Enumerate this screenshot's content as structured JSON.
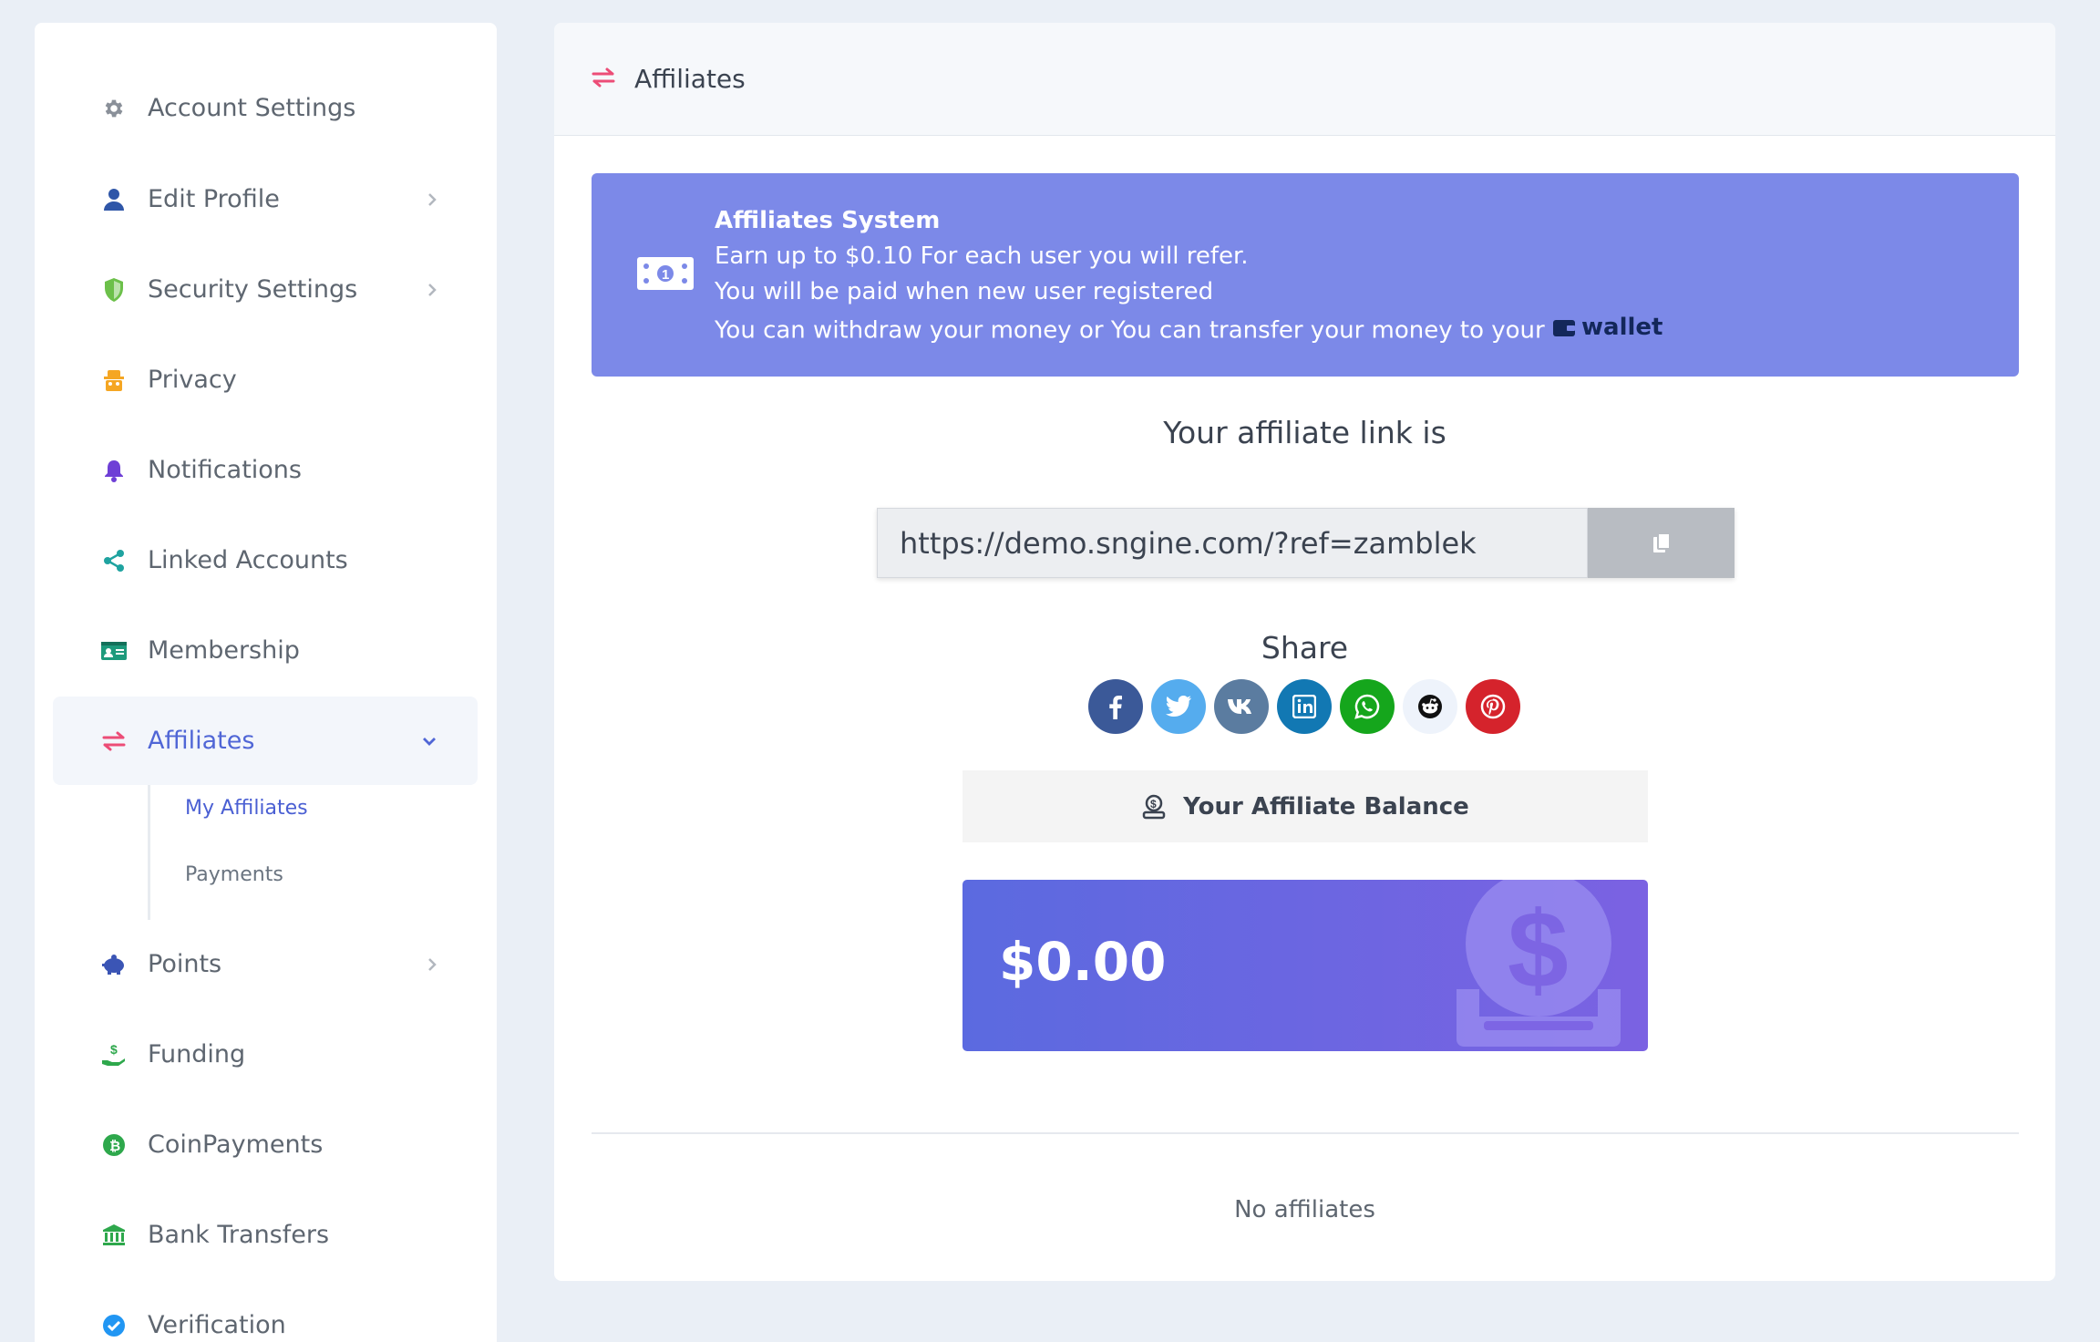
{
  "sidebar": {
    "items": [
      {
        "label": "Account Settings",
        "icon": "gear-icon",
        "color": "#8a9099"
      },
      {
        "label": "Edit Profile",
        "icon": "user-icon",
        "color": "#2f56a8"
      },
      {
        "label": "Security Settings",
        "icon": "shield-icon",
        "color": "#6cc04a"
      },
      {
        "label": "Privacy",
        "icon": "privacy-icon",
        "color": "#f5a623"
      },
      {
        "label": "Notifications",
        "icon": "bell-icon",
        "color": "#6e3fd6"
      },
      {
        "label": "Linked Accounts",
        "icon": "share-nodes-icon",
        "color": "#1fa3a0"
      },
      {
        "label": "Membership",
        "icon": "id-card-icon",
        "color": "#1d9a7c"
      },
      {
        "label": "Affiliates",
        "icon": "exchange-icon",
        "color": "#ec4d77"
      },
      {
        "label": "Points",
        "icon": "piggy-bank-icon",
        "color": "#3b55b5"
      },
      {
        "label": "Funding",
        "icon": "hand-money-icon",
        "color": "#2ea84c"
      },
      {
        "label": "CoinPayments",
        "icon": "bitcoin-icon",
        "color": "#2ea84c"
      },
      {
        "label": "Bank Transfers",
        "icon": "bank-icon",
        "color": "#2ea84c"
      },
      {
        "label": "Verification",
        "icon": "check-circle-icon",
        "color": "#2196f3"
      }
    ],
    "subitems": [
      {
        "label": "My Affiliates"
      },
      {
        "label": "Payments"
      }
    ]
  },
  "header": {
    "title": "Affiliates"
  },
  "alert": {
    "heading": "Affiliates System",
    "line1": "Earn up to $0.10 For each user you will refer.",
    "line2": "You will be paid when new user registered",
    "line3": "You can withdraw your money or You can transfer your money to your",
    "wallet_link": "wallet"
  },
  "affiliate": {
    "link_title": "Your affiliate link is",
    "link": "https://demo.sngine.com/?ref=zamblek"
  },
  "share": {
    "title": "Share",
    "networks": [
      {
        "name": "facebook-icon",
        "bg": "#3b5998"
      },
      {
        "name": "twitter-icon",
        "bg": "#55acee"
      },
      {
        "name": "vk-icon",
        "bg": "#5b7ca0"
      },
      {
        "name": "linkedin-icon",
        "bg": "#1278b3"
      },
      {
        "name": "whatsapp-icon",
        "bg": "#15a61c"
      },
      {
        "name": "reddit-icon",
        "bg": "#eef3fb"
      },
      {
        "name": "pinterest-icon",
        "bg": "#d5232c"
      }
    ]
  },
  "balance": {
    "label": "Your Affiliate Balance",
    "amount": "$0.00"
  },
  "affiliates_list": {
    "empty_text": "No affiliates"
  }
}
